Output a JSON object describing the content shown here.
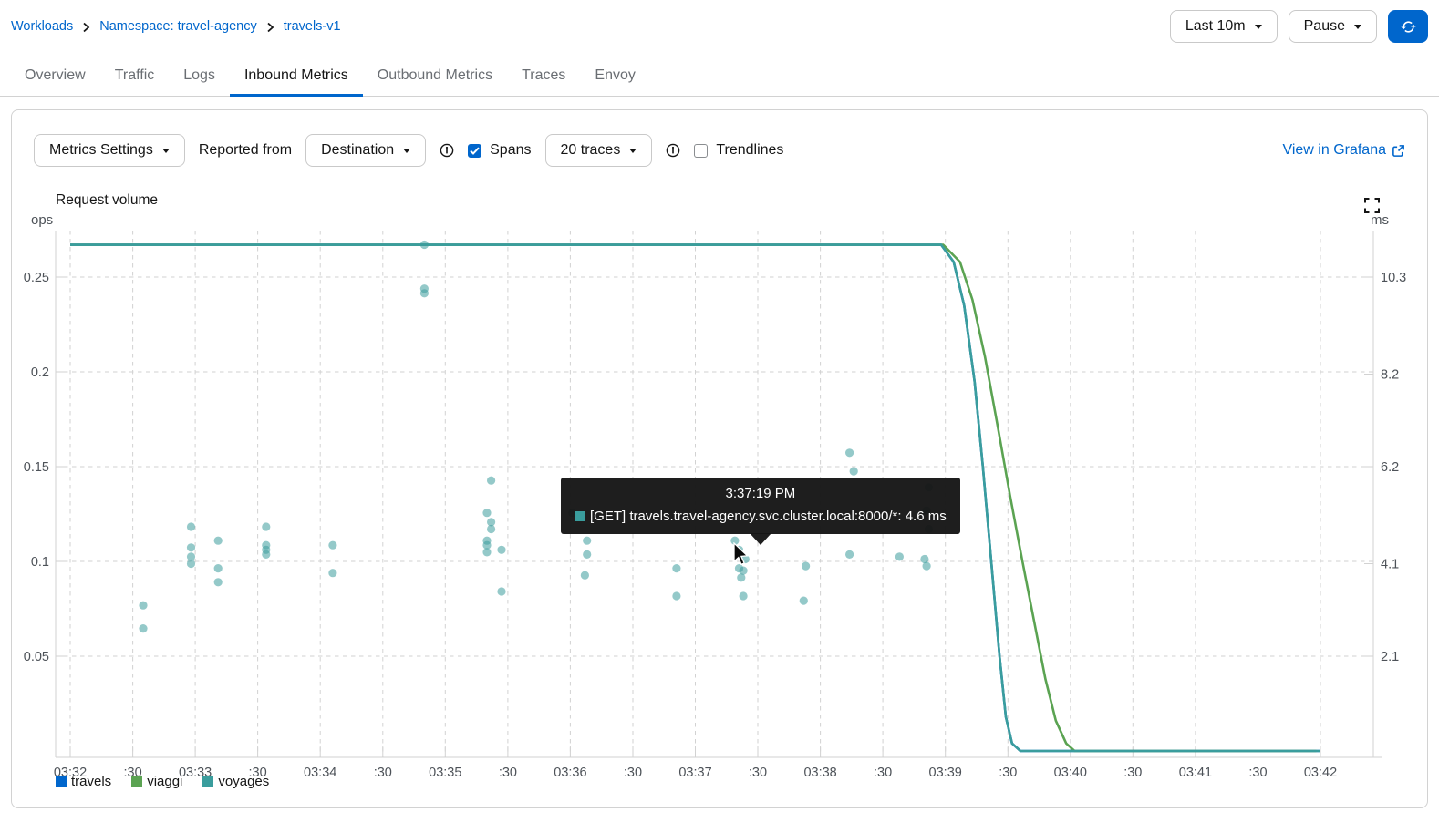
{
  "breadcrumb": {
    "items": [
      {
        "label": "Workloads"
      },
      {
        "label": "Namespace: travel-agency"
      },
      {
        "label": "travels-v1"
      }
    ]
  },
  "header_controls": {
    "duration": "Last 10m",
    "refresh_mode": "Pause"
  },
  "tabs": [
    {
      "label": "Overview"
    },
    {
      "label": "Traffic"
    },
    {
      "label": "Logs"
    },
    {
      "label": "Inbound Metrics"
    },
    {
      "label": "Outbound Metrics"
    },
    {
      "label": "Traces"
    },
    {
      "label": "Envoy"
    }
  ],
  "active_tab": "Inbound Metrics",
  "toolbar": {
    "metrics_settings": "Metrics Settings",
    "reported_from_label": "Reported from",
    "reported_from_value": "Destination",
    "spans_label": "Spans",
    "spans_checked": true,
    "traces_value": "20 traces",
    "trendlines_label": "Trendlines",
    "trendlines_checked": false,
    "grafana_link": "View in Grafana"
  },
  "chart_data": {
    "type": "line",
    "title": "Request volume",
    "left_axis": {
      "label": "ops",
      "ticks": [
        0.05,
        0.1,
        0.15,
        0.2,
        0.25
      ],
      "range": [
        0,
        0.2745
      ]
    },
    "right_axis": {
      "label": "ms",
      "ticks": [
        2.1,
        4.1,
        6.2,
        8.2,
        10.3
      ],
      "range": [
        0,
        11.3
      ]
    },
    "x_axis": {
      "start_time": "03:32",
      "end_time": "03:42",
      "tick_interval_seconds": 30,
      "tick_labels": [
        "03:32",
        ":30",
        "03:33",
        ":30",
        "03:34",
        ":30",
        "03:35",
        ":30",
        "03:36",
        ":30",
        "03:37",
        ":30",
        "03:38",
        ":30",
        "03:39",
        ":30",
        "03:40",
        ":30",
        "03:41",
        ":30",
        "03:42"
      ]
    },
    "grid": true,
    "legend_position": "bottom-left",
    "series": [
      {
        "name": "travels",
        "color": "#0066CC",
        "unit": "ops",
        "steady_value": 0.267,
        "points": [
          [
            0,
            0.267
          ],
          [
            418,
            0.267
          ],
          [
            424,
            0.258
          ],
          [
            429,
            0.235
          ],
          [
            434,
            0.195
          ],
          [
            438,
            0.15
          ],
          [
            442,
            0.1
          ],
          [
            446,
            0.05
          ],
          [
            449,
            0.018
          ],
          [
            452,
            0.004
          ],
          [
            456,
            0
          ],
          [
            600,
            0
          ]
        ]
      },
      {
        "name": "viaggi",
        "color": "#5BA352",
        "unit": "ops",
        "steady_value": 0.267,
        "points": [
          [
            0,
            0.267
          ],
          [
            419,
            0.267
          ],
          [
            427,
            0.258
          ],
          [
            433,
            0.238
          ],
          [
            439,
            0.208
          ],
          [
            445,
            0.172
          ],
          [
            451,
            0.135
          ],
          [
            457,
            0.1
          ],
          [
            463,
            0.066
          ],
          [
            468,
            0.038
          ],
          [
            473,
            0.016
          ],
          [
            478,
            0.004
          ],
          [
            482,
            0
          ],
          [
            598,
            0
          ]
        ]
      },
      {
        "name": "voyages",
        "color": "#3A9D9D",
        "unit": "ops",
        "steady_value": 0.267,
        "points": [
          [
            0,
            0.267
          ],
          [
            418,
            0.267
          ],
          [
            424,
            0.258
          ],
          [
            429,
            0.235
          ],
          [
            434,
            0.195
          ],
          [
            438,
            0.15
          ],
          [
            442,
            0.1
          ],
          [
            446,
            0.05
          ],
          [
            449,
            0.018
          ],
          [
            452,
            0.004
          ],
          [
            456,
            0
          ],
          [
            600,
            0
          ]
        ]
      }
    ],
    "spans": {
      "name": "spans",
      "unit": "ms",
      "color": "rgba(60,157,157,0.55)",
      "points": [
        [
          35,
          3.2
        ],
        [
          35,
          2.7
        ],
        [
          58,
          4.9
        ],
        [
          58,
          4.45
        ],
        [
          58,
          4.25
        ],
        [
          58,
          4.1
        ],
        [
          71,
          4.6
        ],
        [
          71,
          4.0
        ],
        [
          71,
          3.7
        ],
        [
          94,
          4.9
        ],
        [
          94,
          4.5
        ],
        [
          94,
          4.4
        ],
        [
          94,
          4.3
        ],
        [
          126,
          4.5
        ],
        [
          126,
          3.9
        ],
        [
          170,
          11.0
        ],
        [
          170,
          10.05
        ],
        [
          170,
          9.95
        ],
        [
          200,
          5.2
        ],
        [
          200,
          4.6
        ],
        [
          200,
          4.5
        ],
        [
          200,
          4.35
        ],
        [
          202,
          5.9
        ],
        [
          202,
          5.0
        ],
        [
          202,
          4.85
        ],
        [
          207,
          4.4
        ],
        [
          207,
          3.5
        ],
        [
          241,
          5.2
        ],
        [
          248,
          4.6
        ],
        [
          248,
          4.3
        ],
        [
          247,
          3.85
        ],
        [
          291,
          4.0
        ],
        [
          291,
          3.4
        ],
        [
          319,
          4.6
        ],
        [
          321,
          4.4
        ],
        [
          324,
          4.2
        ],
        [
          321,
          4.0
        ],
        [
          323,
          3.95
        ],
        [
          322,
          3.8
        ],
        [
          323,
          3.4
        ],
        [
          353,
          4.05
        ],
        [
          352,
          3.3
        ],
        [
          374,
          6.5
        ],
        [
          376,
          6.1
        ],
        [
          374,
          4.3
        ],
        [
          398,
          4.25
        ],
        [
          412,
          5.75
        ],
        [
          411,
          5.25
        ],
        [
          412,
          4.85
        ],
        [
          410,
          4.2
        ],
        [
          411,
          4.05
        ]
      ]
    }
  },
  "tooltip": {
    "time": "3:37:19 PM",
    "marker_color": "#3A9D9D",
    "text": "[GET] travels.travel-agency.svc.cluster.local:8000/*: 4.6 ms"
  },
  "colors": {
    "accent": "#0066CC",
    "grid": "#d2d2d2"
  }
}
